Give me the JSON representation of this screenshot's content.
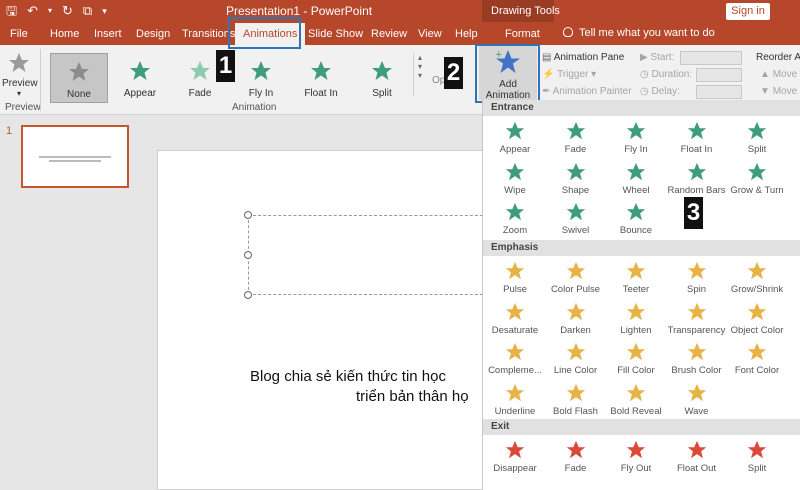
{
  "titlebar": {
    "doc_title": "Presentation1  -  PowerPoint",
    "drawing_tools": "Drawing Tools",
    "sign_in": "Sign in",
    "tell_me": "Tell me what you want to do"
  },
  "tabs": [
    "File",
    "Home",
    "Insert",
    "Design",
    "Transitions",
    "Animations",
    "Slide Show",
    "Review",
    "View",
    "Help",
    "Format"
  ],
  "ribbon": {
    "preview_label": "Preview",
    "preview_group": "Preview",
    "animation_group": "Animation",
    "gallery": [
      "None",
      "Appear",
      "Fade",
      "Fly In",
      "Float In",
      "Split"
    ],
    "effect_options_partial": "Op",
    "add_animation": "Add Animation",
    "add_animation_line1": "Add",
    "add_animation_line2": "Animation",
    "animation_pane": "Animation Pane",
    "trigger": "Trigger",
    "animation_painter": "Animation Painter",
    "start": "Start:",
    "duration": "Duration:",
    "delay": "Delay:",
    "reorder": "Reorder An",
    "move_earlier": "Move E",
    "move_later": "Move L"
  },
  "markers": [
    "1",
    "2",
    "3"
  ],
  "slides_panel": {
    "slide_number": "1"
  },
  "slide": {
    "line1": "Blog chia sẻ kiến thức tin học",
    "line2": "triển bản thân họ"
  },
  "dropdown": {
    "entrance_header": "Entrance",
    "entrance": [
      "Appear",
      "Fade",
      "Fly In",
      "Float In",
      "Split",
      "Wipe",
      "Shape",
      "Wheel",
      "Random Bars",
      "Grow & Turn",
      "Zoom",
      "Swivel",
      "Bounce"
    ],
    "emphasis_header": "Emphasis",
    "emphasis": [
      "Pulse",
      "Color Pulse",
      "Teeter",
      "Spin",
      "Grow/Shrink",
      "Desaturate",
      "Darken",
      "Lighten",
      "Transparency",
      "Object Color",
      "Compleme...",
      "Line Color",
      "Fill Color",
      "Brush Color",
      "Font Color",
      "Underline",
      "Bold Flash",
      "Bold Reveal",
      "Wave"
    ],
    "exit_header": "Exit",
    "exit": [
      "Disappear",
      "Fade",
      "Fly Out",
      "Float Out",
      "Split"
    ]
  },
  "colors": {
    "accent": "#b7472a",
    "entrance_star": "#3f9c7c",
    "emphasis_star": "#e7b347",
    "exit_star": "#d94a3a",
    "highlight_box": "#2e75b6"
  }
}
